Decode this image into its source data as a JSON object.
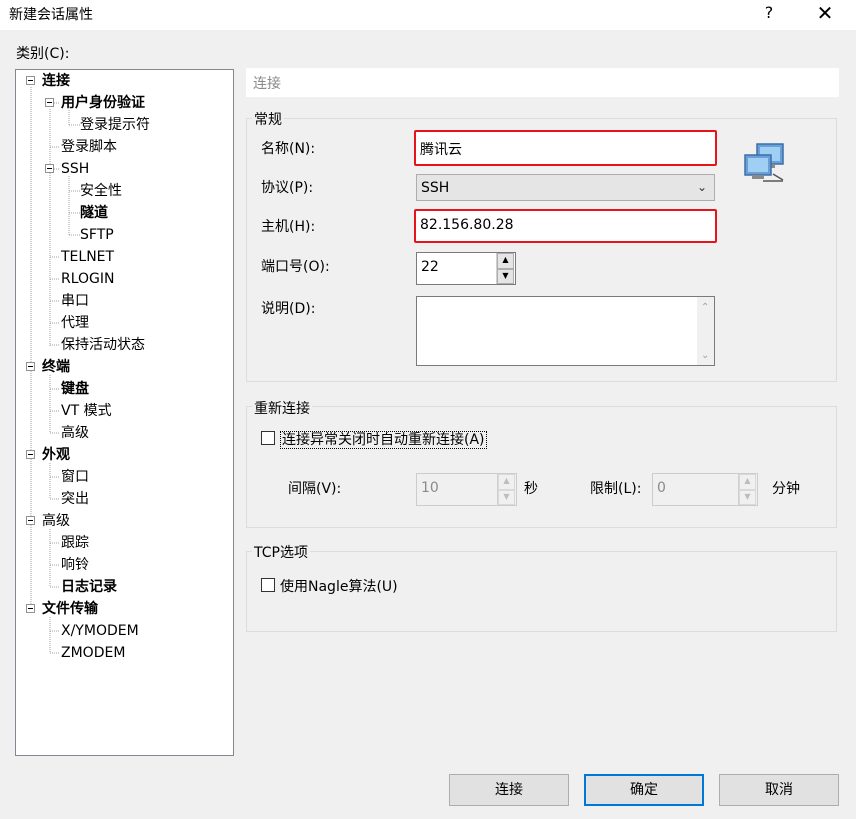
{
  "window": {
    "title": "新建会话属性",
    "help_label": "?",
    "close_label": "✕"
  },
  "category_label": "类别(C):",
  "tree": {
    "items": [
      {
        "label": "连接",
        "bold": true,
        "expander": true
      },
      {
        "label": "用户身份验证",
        "bold": true,
        "expander": true
      },
      {
        "label": "登录提示符",
        "bold": false
      },
      {
        "label": "登录脚本",
        "bold": false
      },
      {
        "label": "SSH",
        "bold": false,
        "expander": true
      },
      {
        "label": "安全性",
        "bold": false
      },
      {
        "label": "隧道",
        "bold": true
      },
      {
        "label": "SFTP",
        "bold": false
      },
      {
        "label": "TELNET",
        "bold": false
      },
      {
        "label": "RLOGIN",
        "bold": false
      },
      {
        "label": "串口",
        "bold": false
      },
      {
        "label": "代理",
        "bold": false
      },
      {
        "label": "保持活动状态",
        "bold": false
      },
      {
        "label": "终端",
        "bold": true,
        "expander": true
      },
      {
        "label": "键盘",
        "bold": true
      },
      {
        "label": "VT 模式",
        "bold": false
      },
      {
        "label": "高级",
        "bold": false
      },
      {
        "label": "外观",
        "bold": true,
        "expander": true
      },
      {
        "label": "窗口",
        "bold": false
      },
      {
        "label": "突出",
        "bold": false
      },
      {
        "label": "高级",
        "bold": false,
        "expander": true
      },
      {
        "label": "跟踪",
        "bold": false
      },
      {
        "label": "响铃",
        "bold": false
      },
      {
        "label": "日志记录",
        "bold": true
      },
      {
        "label": "文件传输",
        "bold": true,
        "expander": true
      },
      {
        "label": "X/YMODEM",
        "bold": false
      },
      {
        "label": "ZMODEM",
        "bold": false
      }
    ]
  },
  "panel_title": "连接",
  "general": {
    "title": "常规",
    "name_label": "名称(N):",
    "name_value": "腾讯云",
    "protocol_label": "协议(P):",
    "protocol_value": "SSH",
    "host_label": "主机(H):",
    "host_value": "82.156.80.28",
    "port_label": "端口号(O):",
    "port_value": "22",
    "desc_label": "说明(D):",
    "desc_value": ""
  },
  "reconnect": {
    "title": "重新连接",
    "checkbox_label": "连接异常关闭时自动重新连接(A)",
    "checked": false,
    "interval_label": "间隔(V):",
    "interval_value": "10",
    "interval_unit": "秒",
    "limit_label": "限制(L):",
    "limit_value": "0",
    "limit_unit": "分钟"
  },
  "tcp": {
    "title": "TCP选项",
    "nagle_label": "使用Nagle算法(U)",
    "checked": false
  },
  "buttons": {
    "connect": "连接",
    "ok": "确定",
    "cancel": "取消"
  },
  "colors": {
    "highlight_box": "#e8141b",
    "default_button_border": "#0078d7"
  },
  "icons": {
    "session_icon": "network-computers-icon"
  }
}
